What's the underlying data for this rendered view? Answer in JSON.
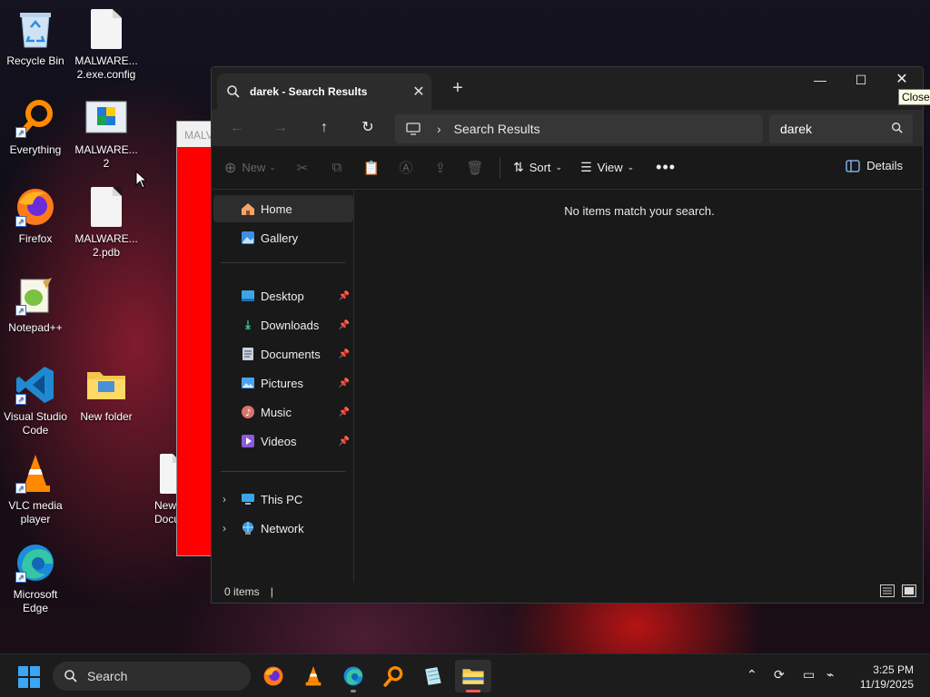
{
  "desktop": {
    "icons": [
      {
        "label": "Recycle Bin",
        "icon": "recycle-bin-icon"
      },
      {
        "label": "MALWARE...\n2.exe.config",
        "icon": "file-icon"
      },
      {
        "label": "Everything",
        "icon": "everything-search-icon"
      },
      {
        "label": "MALWARE...\n2",
        "icon": "installer-icon"
      },
      {
        "label": "Firefox",
        "icon": "firefox-icon"
      },
      {
        "label": "MALWARE...\n2.pdb",
        "icon": "file-icon"
      },
      {
        "label": "Notepad++",
        "icon": "notepad-plus-plus-icon"
      },
      {
        "label": "Visual Studio\nCode",
        "icon": "vscode-icon"
      },
      {
        "label": "New folder",
        "icon": "folder-icon"
      },
      {
        "label": "VLC media\nplayer",
        "icon": "vlc-icon"
      },
      {
        "label": "New\nDocu",
        "icon": "document-icon"
      },
      {
        "label": "Microsoft\nEdge",
        "icon": "edge-icon"
      }
    ],
    "background_window_title": "MALV"
  },
  "explorer": {
    "tab_title": "darek - Search Results",
    "tooltip": "Close",
    "address": {
      "location": "Search Results"
    },
    "search": {
      "value": "darek"
    },
    "commands": {
      "new": "New",
      "sort": "Sort",
      "view": "View",
      "details": "Details"
    },
    "nav": {
      "home": "Home",
      "gallery": "Gallery",
      "desktop": "Desktop",
      "downloads": "Downloads",
      "documents": "Documents",
      "pictures": "Pictures",
      "music": "Music",
      "videos": "Videos",
      "this_pc": "This PC",
      "network": "Network"
    },
    "empty_message": "No items match your search.",
    "status": {
      "item_count": "0 items"
    }
  },
  "taskbar": {
    "search_label": "Search",
    "apps": [
      "firefox-icon",
      "vlc-icon",
      "edge-icon",
      "everything-search-icon",
      "notepad-plus-plus-icon",
      "file-explorer-icon"
    ],
    "clock": {
      "time": "3:25 PM",
      "date": "11/19/2025"
    }
  }
}
